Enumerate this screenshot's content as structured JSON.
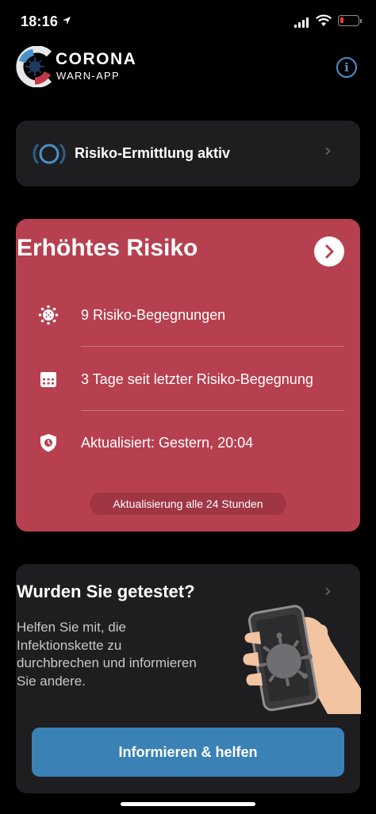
{
  "status_bar": {
    "time": "18:16"
  },
  "header": {
    "brand_title": "CORONA",
    "brand_subtitle": "WARN-APP",
    "info_label": "i"
  },
  "tracing": {
    "label": "Risiko-Ermittlung aktiv",
    "chevron": "›"
  },
  "risk": {
    "title": "Erhöhtes Risiko",
    "color": "#b6404f",
    "rows": [
      {
        "icon": "virus-icon",
        "text": "9 Risiko-Begegnungen"
      },
      {
        "icon": "calendar-icon",
        "text": "3 Tage seit letzter Risiko-Begegnung"
      },
      {
        "icon": "shield-clock-icon",
        "text": "Aktualisiert: Gestern, 20:04"
      }
    ],
    "update_interval": "Aktualisierung alle 24 Stunden"
  },
  "test": {
    "title": "Wurden Sie getestet?",
    "chevron": "›",
    "body": "Helfen Sie mit, die Infektionskette zu durchbrechen und informieren Sie andere.",
    "button": "Informieren & helfen"
  },
  "colors": {
    "accent": "#3a82b5",
    "risk_high": "#b6404f",
    "card_dark": "#1e1e20"
  }
}
